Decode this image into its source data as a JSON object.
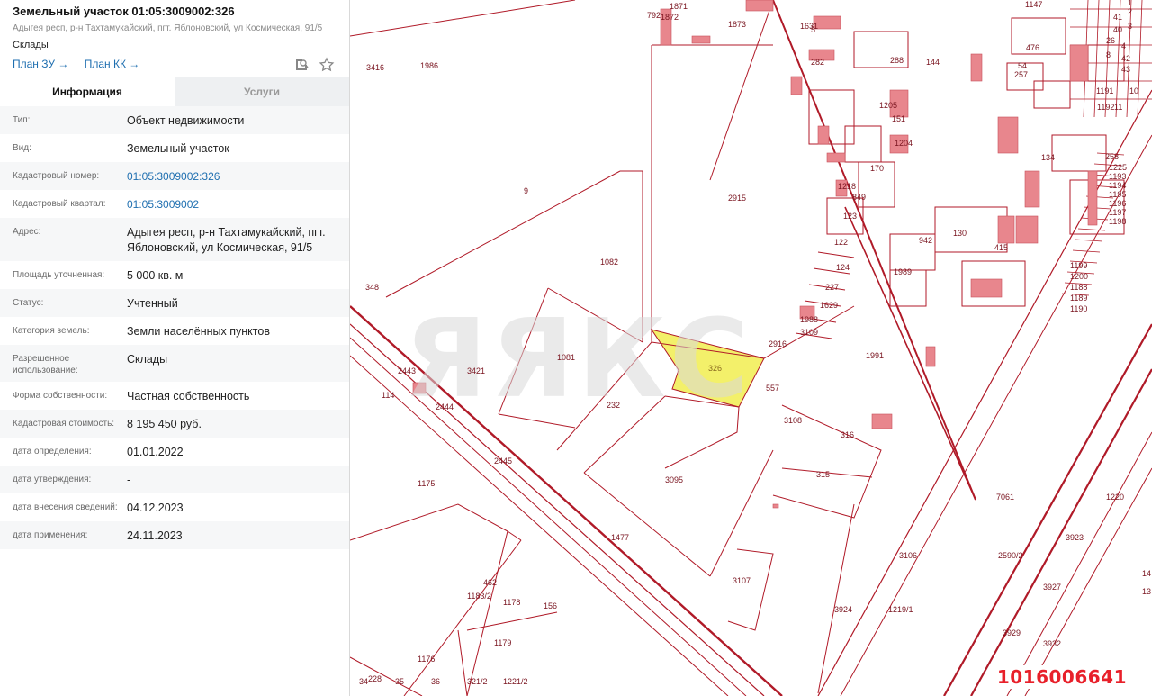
{
  "header": {
    "title": "Земельный участок 01:05:3009002:326",
    "address": "Адыгея респ, р-н Тахтамукайский, пгт. Яблоновский, ул Космическая, 91/5",
    "use": "Склады",
    "plan_zu": "План ЗУ →",
    "plan_kk": "План КК →"
  },
  "tabs": {
    "info": "Информация",
    "services": "Услуги"
  },
  "rows": [
    {
      "k": "Тип:",
      "v": "Объект недвижимости"
    },
    {
      "k": "Вид:",
      "v": "Земельный участок"
    },
    {
      "k": "Кадастровый номер:",
      "v": "01:05:3009002:326"
    },
    {
      "k": "Кадастровый квартал:",
      "v": "01:05:3009002"
    },
    {
      "k": "Адрес:",
      "v": "Адыгея респ, р-н Тахтамукайский, пгт. Яблоновский, ул Космическая, 91/5"
    },
    {
      "k": "Площадь уточненная:",
      "v": "5 000 кв. м"
    },
    {
      "k": "Статус:",
      "v": "Учтенный"
    },
    {
      "k": "Категория земель:",
      "v": "Земли населённых пунктов"
    },
    {
      "k": "Разрешенное использование:",
      "v": "Склады"
    },
    {
      "k": "Форма собственности:",
      "v": "Частная собственность"
    },
    {
      "k": "Кадастровая стоимость:",
      "v": "8 195 450 руб."
    },
    {
      "k": "дата определения:",
      "v": "01.01.2022"
    },
    {
      "k": "дата утверждения:",
      "v": "-"
    },
    {
      "k": "дата внесения сведений:",
      "v": "04.12.2023"
    },
    {
      "k": "дата применения:",
      "v": "24.11.2023"
    }
  ],
  "map": {
    "selected_label": "326",
    "watermark": "ЯЯКС",
    "id_badge": "1016006641",
    "labels": [
      "3416",
      "1986",
      "9",
      "1082",
      "1081",
      "3421",
      "348",
      "2443",
      "114",
      "232",
      "2444",
      "2445",
      "1175",
      "3095",
      "1477",
      "1178",
      "156",
      "1179",
      "1176",
      "228",
      "1183/2",
      "462",
      "2915",
      "557",
      "2916",
      "3108",
      "1991",
      "316",
      "315",
      "3106",
      "3107",
      "1219/1",
      "2590/2",
      "1220",
      "3923",
      "3927",
      "3924",
      "3932",
      "3929",
      "7061",
      "792",
      "1871",
      "1872",
      "1873",
      "1631",
      "5",
      "282",
      "288",
      "144",
      "151",
      "1204",
      "1205",
      "170",
      "1218",
      "849",
      "123",
      "122",
      "124",
      "227",
      "1629",
      "1988",
      "3109",
      "1989",
      "942",
      "130",
      "415",
      "134",
      "1147",
      "476",
      "54",
      "257",
      "258",
      "1225",
      "1193",
      "1194",
      "1195",
      "1196",
      "1197",
      "1198",
      "1199",
      "1200",
      "1188",
      "1189",
      "1190",
      "1191",
      "1192",
      "11",
      "10",
      "8",
      "26",
      "40",
      "41",
      "42",
      "43",
      "4",
      "3",
      "2",
      "1",
      "13",
      "14",
      "34",
      "35",
      "36",
      "321/2",
      "1221/2"
    ]
  }
}
